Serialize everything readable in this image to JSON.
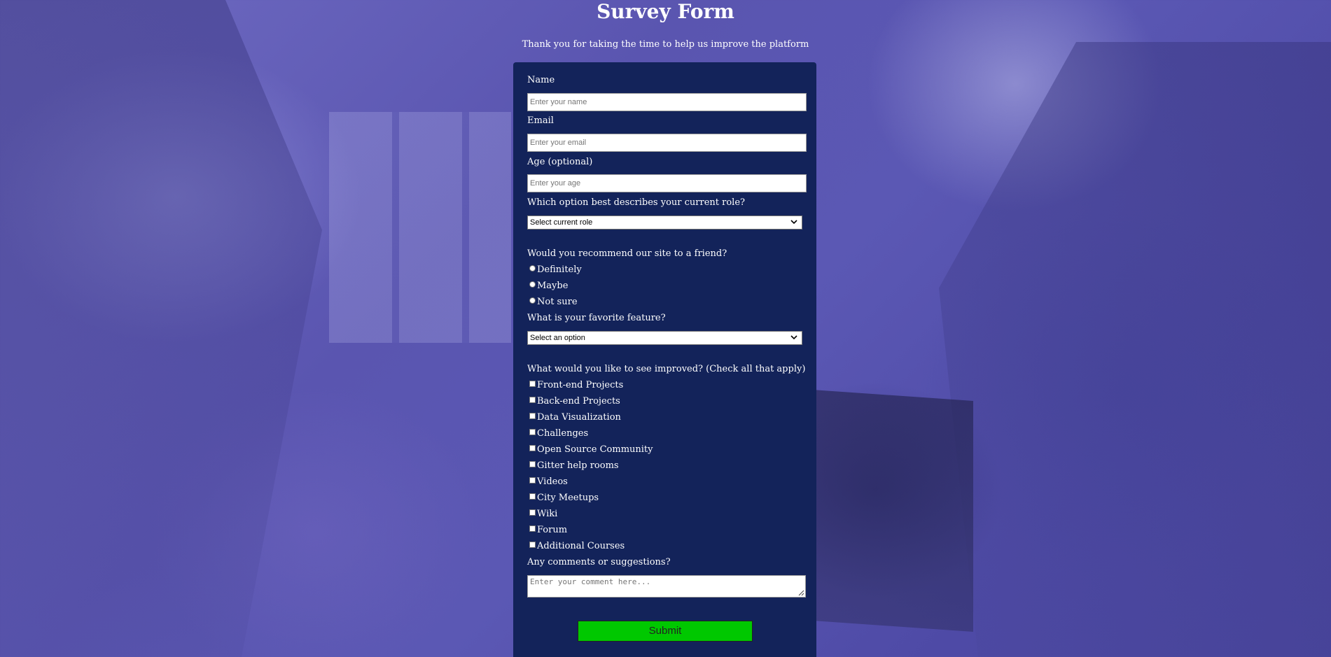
{
  "header": {
    "title": "Survey Form",
    "description": "Thank you for taking the time to help us improve the platform"
  },
  "form": {
    "name": {
      "label": "Name",
      "placeholder": "Enter your name"
    },
    "email": {
      "label": "Email",
      "placeholder": "Enter your email"
    },
    "age": {
      "label": "Age (optional)",
      "placeholder": "Enter your age"
    },
    "role": {
      "label": "Which option best describes your current role?",
      "selected": "Select current role"
    },
    "recommend": {
      "label": "Would you recommend our site to a friend?",
      "options": [
        "Definitely",
        "Maybe",
        "Not sure"
      ]
    },
    "feature": {
      "label": "What is your favorite feature?",
      "selected": "Select an option"
    },
    "improve": {
      "label": "What would you like to see improved? (Check all that apply)",
      "options": [
        "Front-end Projects",
        "Back-end Projects",
        "Data Visualization",
        "Challenges",
        "Open Source Community",
        "Gitter help rooms",
        "Videos",
        "City Meetups",
        "Wiki",
        "Forum",
        "Additional Courses"
      ]
    },
    "comments": {
      "label": "Any comments or suggestions?",
      "placeholder": "Enter your comment here..."
    },
    "submit_label": "Submit"
  },
  "colors": {
    "panel_bg": "#13235a",
    "submit_bg": "#00c800",
    "background_tint": "#5a55b0"
  },
  "icons": {
    "select_arrow": "chevron-down-icon",
    "textarea_grip": "resize-grip-icon"
  }
}
